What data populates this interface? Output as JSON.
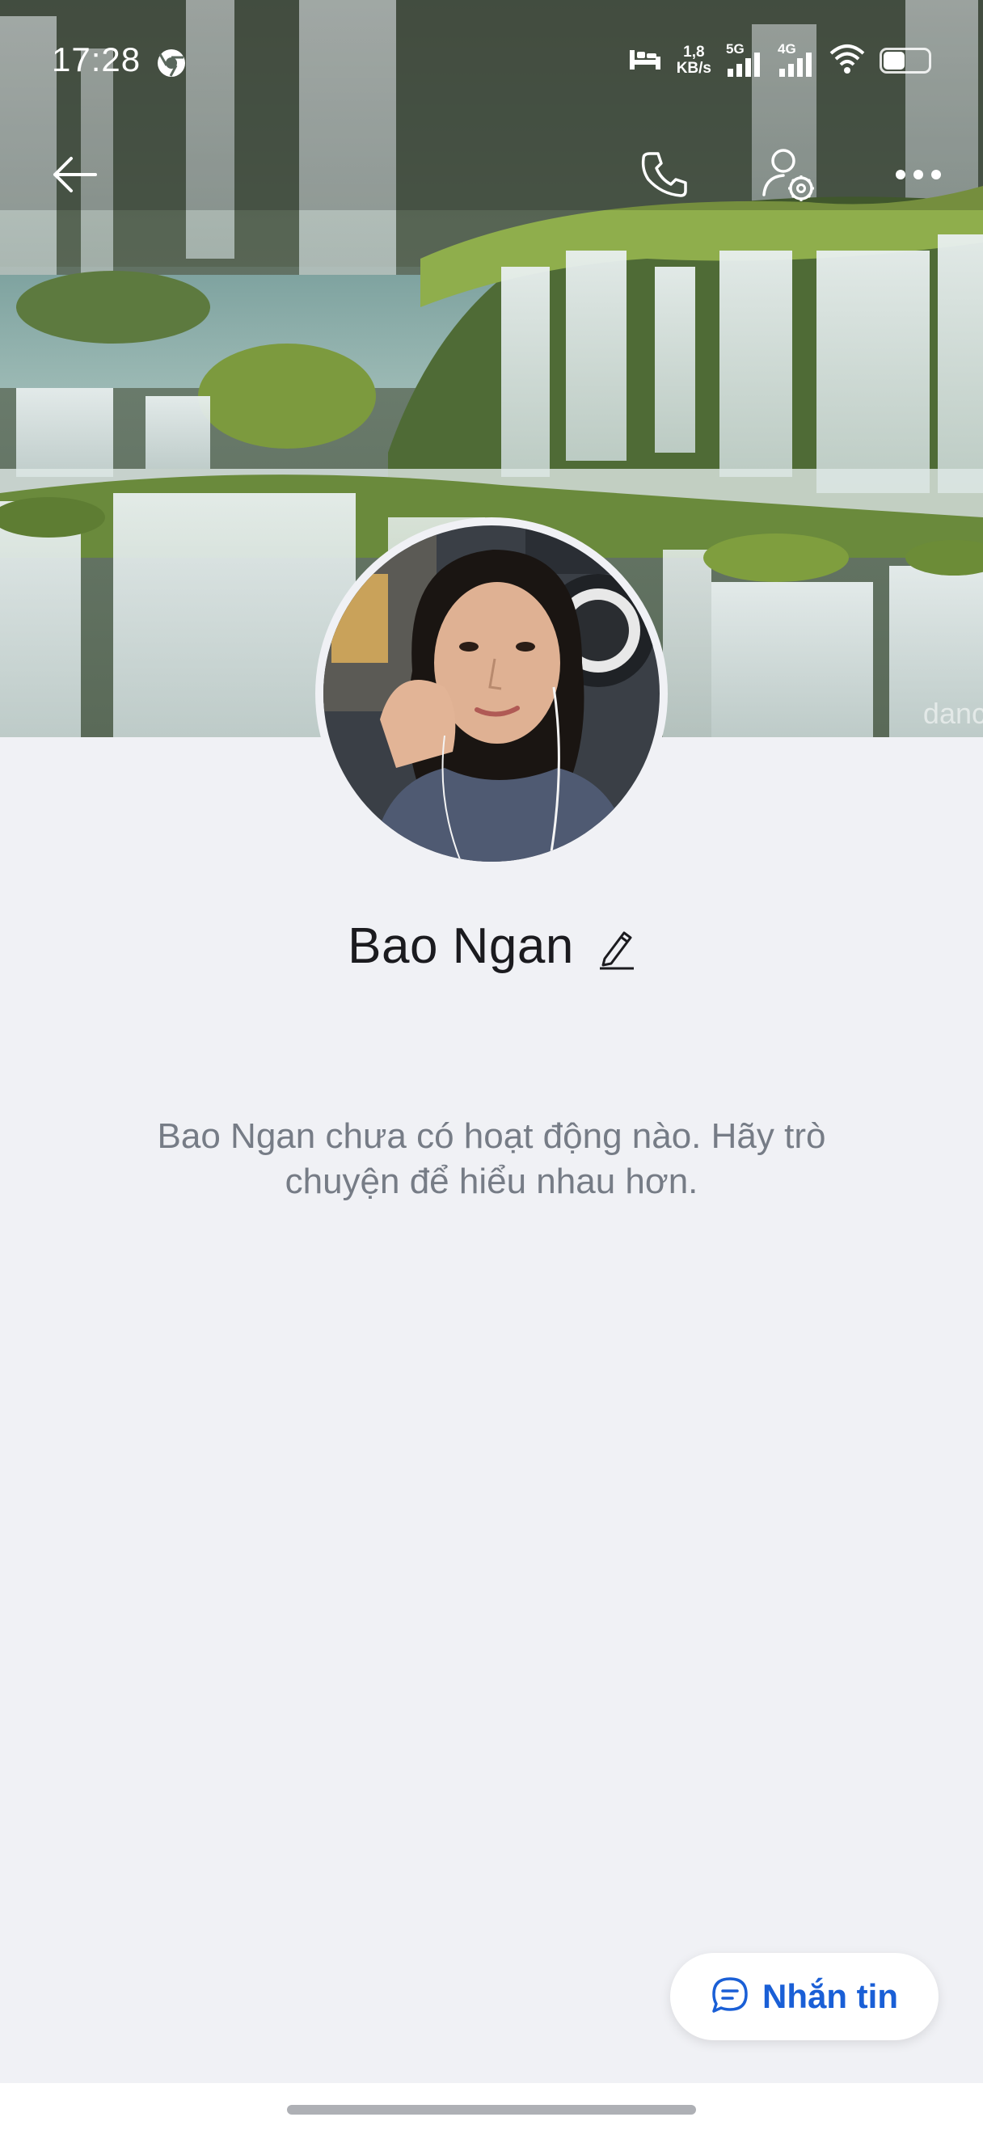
{
  "status_bar": {
    "time": "17:28",
    "net_speed_value": "1,8",
    "net_speed_unit": "KB/s",
    "sim1_label": "5G",
    "sim2_label": "4G"
  },
  "cover": {
    "watermark": "danc"
  },
  "toolbar": {
    "back_icon": "arrow-left-icon",
    "call_icon": "phone-icon",
    "settings_icon": "user-settings-icon",
    "more_icon": "more-horizontal-icon"
  },
  "profile": {
    "name": "Bao Ngan",
    "empty_message": "Bao Ngan chưa có hoạt động nào. Hãy trò chuyện để hiểu nhau hơn."
  },
  "message_button": {
    "label": "Nhắn tin",
    "icon": "chat-bubble-icon"
  },
  "colors": {
    "accent": "#1a5fd6",
    "background": "#f0f1f5",
    "muted_text": "#767c86"
  }
}
